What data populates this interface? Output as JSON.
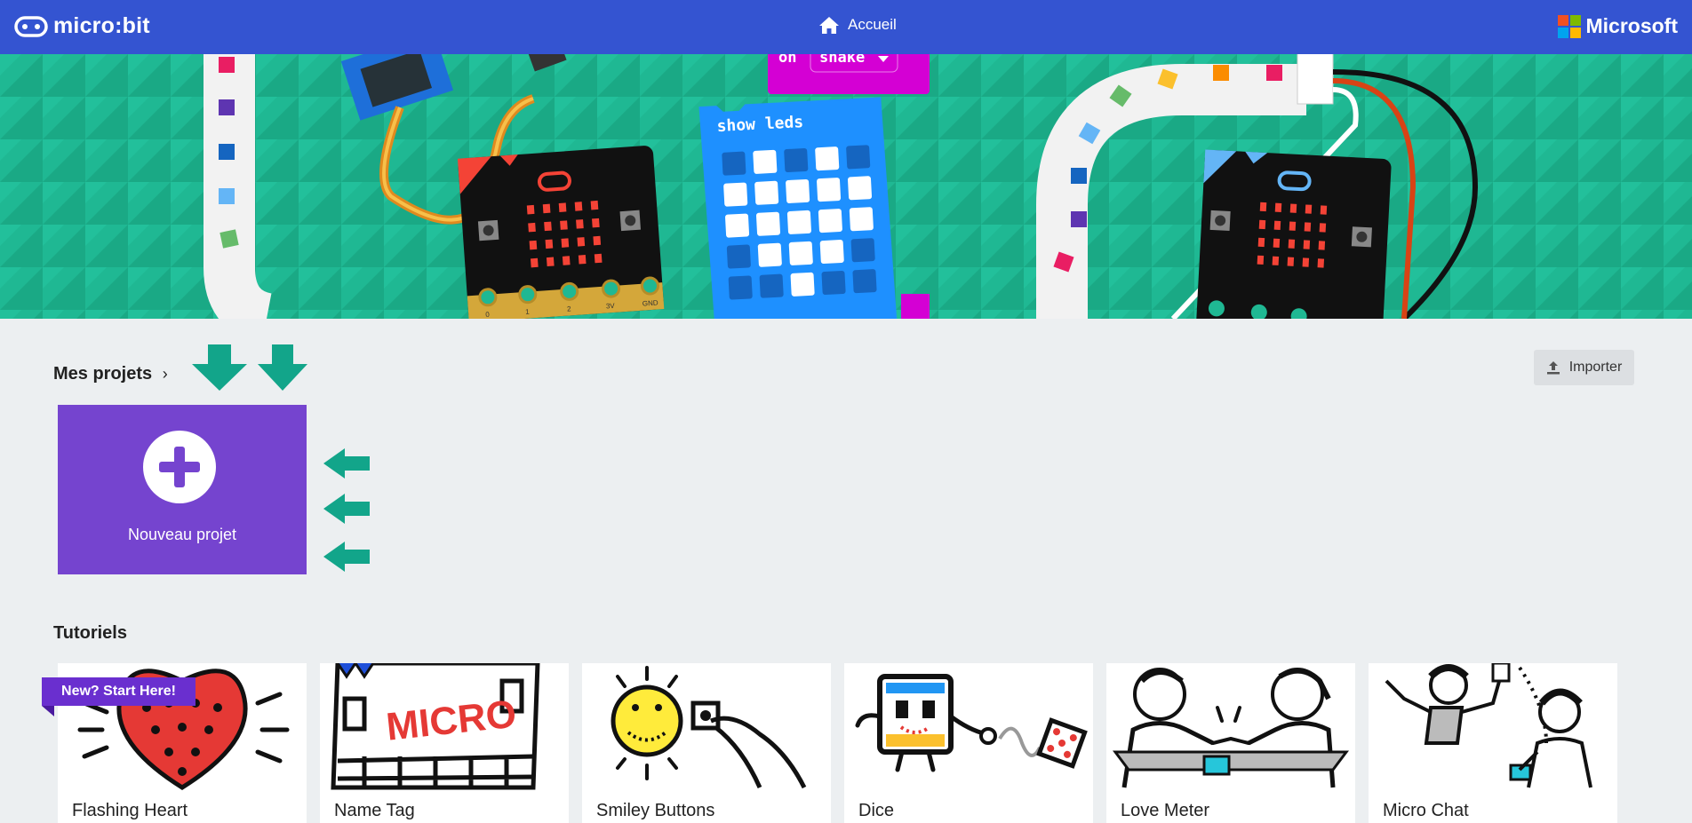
{
  "header": {
    "brand": "micro:bit",
    "home_label": "Accueil",
    "microsoft_label": "Microsoft",
    "bar_color": "#3454d1"
  },
  "hero": {
    "event_block": "on",
    "event_value": "shake",
    "leds_block": "show leds",
    "pin_labels": [
      "0",
      "1",
      "2",
      "3V",
      "GND"
    ]
  },
  "projects": {
    "title": "Mes projets",
    "import_label": "Importer",
    "new_project_label": "Nouveau projet",
    "new_project_color": "#7544cf"
  },
  "tutorials": {
    "title": "Tutoriels",
    "badge": "New? Start Here!",
    "cards": [
      {
        "title": "Flashing Heart"
      },
      {
        "title": "Name Tag"
      },
      {
        "title": "Smiley Buttons"
      },
      {
        "title": "Dice"
      },
      {
        "title": "Love Meter"
      },
      {
        "title": "Micro Chat"
      }
    ],
    "name_tag_text": "MICRO"
  },
  "accent_arrow_color": "#12a58a"
}
